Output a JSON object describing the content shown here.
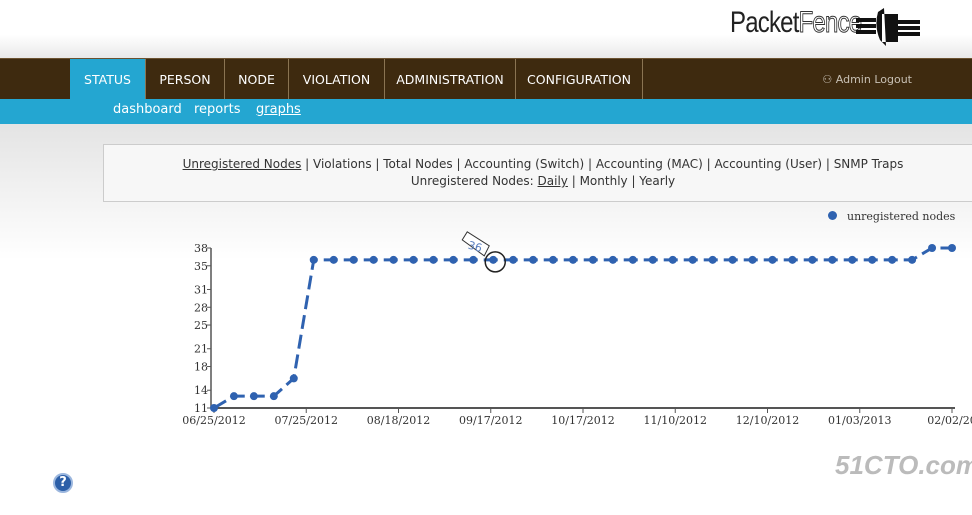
{
  "header": {
    "logo_text": "PacketFence",
    "admin": "Admin Logout"
  },
  "nav": {
    "tabs": [
      "STATUS",
      "PERSON",
      "NODE",
      "VIOLATION",
      "ADMINISTRATION",
      "CONFIGURATION"
    ],
    "active": "STATUS"
  },
  "subnav": {
    "items": [
      "dashboard",
      "reports",
      "graphs"
    ],
    "active": "graphs"
  },
  "graph_links": {
    "types": [
      "Unregistered Nodes",
      "Violations",
      "Total Nodes",
      "Accounting (Switch)",
      "Accounting (MAC)",
      "Accounting (User)",
      "SNMP Traps"
    ],
    "period_label": "Unregistered Nodes:",
    "periods": [
      "Daily",
      "Monthly",
      "Yearly"
    ]
  },
  "colors": {
    "nav": "#3e2a0f",
    "accent": "#24a6d1",
    "series": "#2f62b0"
  },
  "watermark": "51CTO.com",
  "chart_data": {
    "type": "line",
    "legend": [
      "unregistered nodes"
    ],
    "legend_position": "top-right",
    "ylim": [
      11,
      38
    ],
    "yticks": [
      11,
      14,
      18,
      21,
      25,
      28,
      31,
      35,
      38
    ],
    "xticks": [
      "06/25/2012",
      "07/25/2012",
      "08/18/2012",
      "09/17/2012",
      "10/17/2012",
      "11/10/2012",
      "12/10/2012",
      "01/03/2013",
      "02/02/20"
    ],
    "series": [
      {
        "name": "unregistered nodes",
        "values": [
          11,
          13,
          13,
          13,
          16,
          36,
          36,
          36,
          36,
          36,
          36,
          36,
          36,
          36,
          36,
          36,
          36,
          36,
          36,
          36,
          36,
          36,
          36,
          36,
          36,
          36,
          36,
          36,
          36,
          36,
          36,
          36,
          36,
          36,
          36,
          36,
          38,
          38
        ]
      }
    ],
    "tooltip": {
      "index": 14,
      "value": "36"
    }
  }
}
